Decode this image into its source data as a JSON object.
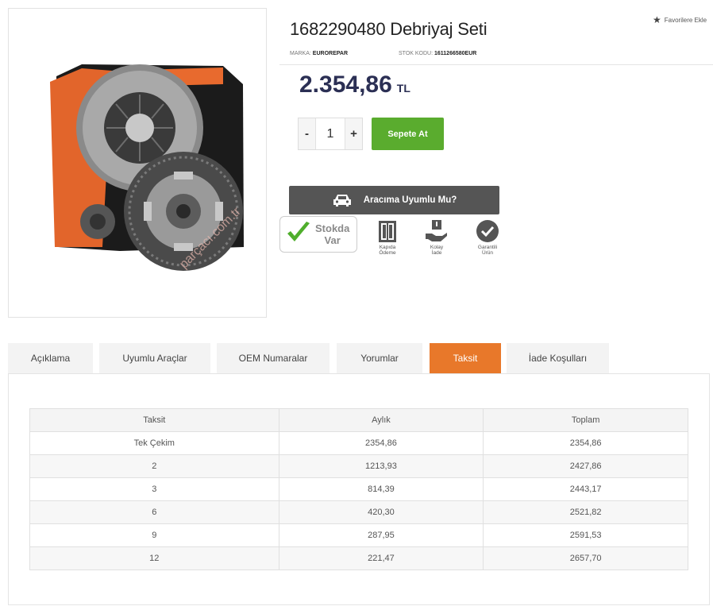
{
  "product": {
    "title": "1682290480 Debriyaj Seti",
    "favorite_label": "Favorilere Ekle",
    "brand_label": "MARKA:",
    "brand": "EUROREPAR",
    "stock_code_label": "STOK KODU:",
    "stock_code": "1611266580EUR",
    "price": "2.354,86",
    "currency": "TL",
    "quantity": "1",
    "qty_minus": "-",
    "qty_plus": "+",
    "add_to_cart_label": "Sepete At",
    "compat_label": "Aracıma Uyumlu Mu?",
    "image_watermark": "parçacı.com.tr"
  },
  "badges": {
    "stock_line1": "Stokda",
    "stock_line2": "Var",
    "door_line1": "Kapıda",
    "door_line2": "Ödeme",
    "return_line1": "Kolay",
    "return_line2": "İade",
    "guarantee_line1": "Garantili",
    "guarantee_line2": "Ürün"
  },
  "tabs": [
    {
      "label": "Açıklama",
      "active": false
    },
    {
      "label": "Uyumlu Araçlar",
      "active": false
    },
    {
      "label": "OEM Numaralar",
      "active": false
    },
    {
      "label": "Yorumlar",
      "active": false
    },
    {
      "label": "Taksit",
      "active": true
    },
    {
      "label": "İade Koşulları",
      "active": false
    }
  ],
  "installments": {
    "headers": [
      "Taksit",
      "Aylık",
      "Toplam"
    ],
    "rows": [
      [
        "Tek Çekim",
        "2354,86",
        "2354,86"
      ],
      [
        "2",
        "1213,93",
        "2427,86"
      ],
      [
        "3",
        "814,39",
        "2443,17"
      ],
      [
        "6",
        "420,30",
        "2521,82"
      ],
      [
        "9",
        "287,95",
        "2591,53"
      ],
      [
        "12",
        "221,47",
        "2657,70"
      ]
    ]
  },
  "colors": {
    "accent_orange": "#e8782a",
    "cart_green": "#5aac2e",
    "price_navy": "#2b2f54",
    "compat_gray": "#555555"
  }
}
